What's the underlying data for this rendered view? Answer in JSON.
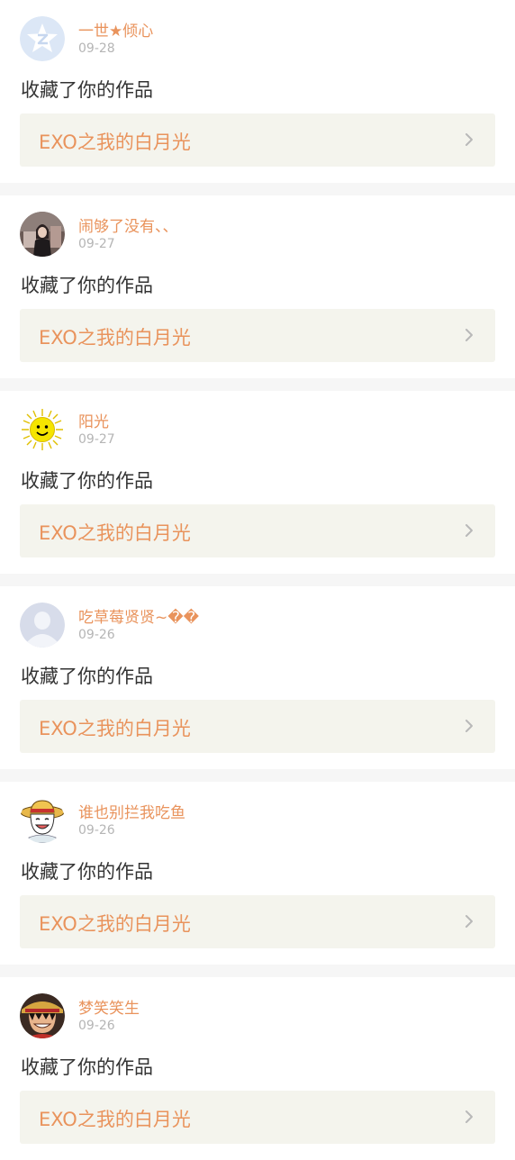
{
  "notifications": [
    {
      "username": "一世★倾心",
      "date": "09-28",
      "action": "收藏了你的作品",
      "work_title": "EXO之我的白月光",
      "avatar_icon": "qzone-star-logo-icon"
    },
    {
      "username": "闹够了没有、、",
      "date": "09-27",
      "action": "收藏了你的作品",
      "work_title": "EXO之我的白月光",
      "avatar_icon": "user-photo-avatar"
    },
    {
      "username": "阳光",
      "date": "09-27",
      "action": "收藏了你的作品",
      "work_title": "EXO之我的白月光",
      "avatar_icon": "smiling-sun-icon"
    },
    {
      "username": "吃草莓贤贤~��",
      "date": "09-26",
      "action": "收藏了你的作品",
      "work_title": "EXO之我的白月光",
      "avatar_icon": "default-person-icon"
    },
    {
      "username": "谁也别拦我吃鱼",
      "date": "09-26",
      "action": "收藏了你的作品",
      "work_title": "EXO之我的白月光",
      "avatar_icon": "straw-hat-cartoon-avatar"
    },
    {
      "username": "梦笑笑生",
      "date": "09-26",
      "action": "收藏了你的作品",
      "work_title": "EXO之我的白月光",
      "avatar_icon": "straw-hat-cartoon-avatar"
    }
  ],
  "colors": {
    "accent": "#e9935c",
    "date_text": "#b5b5b5",
    "body_text": "#333333",
    "work_card_bg": "#f4f4ed",
    "divider": "#f6f6f6"
  }
}
